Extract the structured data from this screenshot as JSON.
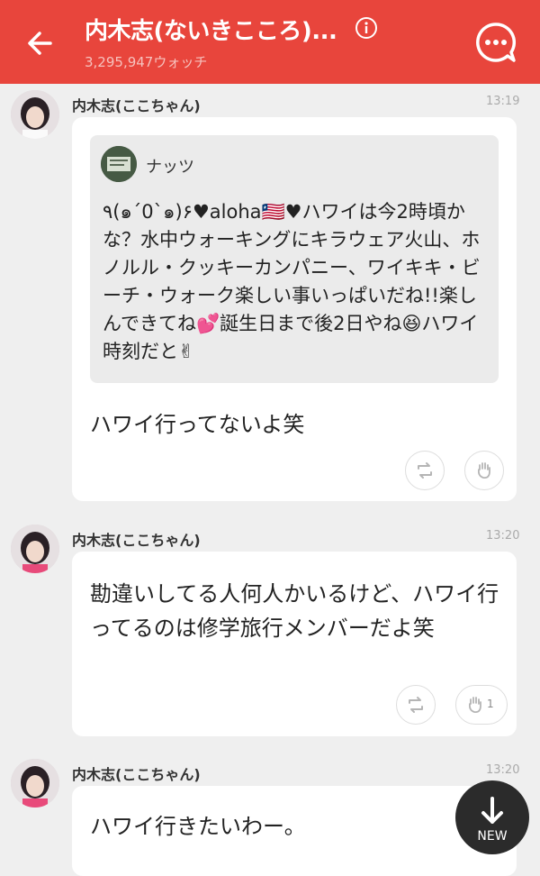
{
  "header": {
    "title": "内木志(ないきこころ)...",
    "watchers": "3,295,947ウォッチ"
  },
  "messages": [
    {
      "author": "内木志(ここちゃん)",
      "time": "13:19",
      "quote": {
        "name": "ナッツ",
        "text": "٩(๑´0`๑)۶♥aloha🇱🇷♥ハワイは今2時頃かな？水中ウォーキングにキラウェア火山、ホノルル・クッキーカンパニー、ワイキキ・ビーチ・ウォーク楽しい事いっぱいだね!!楽しんできてね💕誕生日まで後2日やね😆ハワイ時刻だと✌"
      },
      "text": "ハワイ行ってないよ笑"
    },
    {
      "author": "内木志(ここちゃん)",
      "time": "13:20",
      "text": "勘違いしてる人何人かいるけど、ハワイ行ってるのは修学旅行メンバーだよ笑",
      "clap_count": "1"
    },
    {
      "author": "内木志(ここちゃん)",
      "time": "13:20",
      "text": "ハワイ行きたいわー。"
    }
  ],
  "new_button": {
    "label": "NEW"
  },
  "colors": {
    "header": "#e8453c",
    "background": "#efefef",
    "card": "#ffffff",
    "quote": "#ebebeb"
  },
  "icons": [
    "back-arrow-icon",
    "info-icon",
    "chat-bubble-icon",
    "retweet-icon",
    "clap-icon",
    "down-arrow-icon"
  ]
}
